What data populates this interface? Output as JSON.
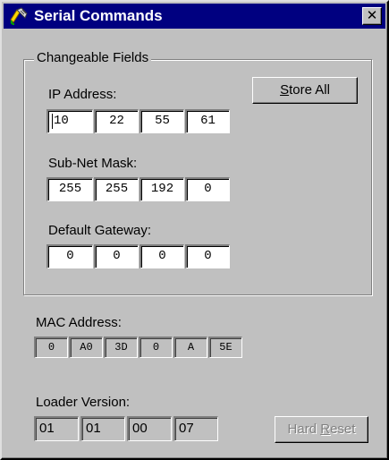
{
  "window": {
    "title": "Serial Commands",
    "icon": "serial-plug-icon",
    "close_label": "✕"
  },
  "changeable": {
    "legend": "Changeable Fields",
    "store_all": {
      "prefix": "",
      "accel": "S",
      "suffix": "tore All"
    },
    "ip_address": {
      "label": "IP Address:",
      "octets": [
        "10",
        "22",
        "55",
        "61"
      ]
    },
    "subnet_mask": {
      "label": "Sub-Net Mask:",
      "octets": [
        "255",
        "255",
        "192",
        "0"
      ]
    },
    "default_gateway": {
      "label": "Default Gateway:",
      "octets": [
        "0",
        "0",
        "0",
        "0"
      ]
    }
  },
  "mac_address": {
    "label": "MAC Address:",
    "bytes": [
      "0",
      "A0",
      "3D",
      "0",
      "A",
      "5E"
    ]
  },
  "loader_version": {
    "label": "Loader Version:",
    "parts": [
      "01",
      "01",
      "00",
      "07"
    ]
  },
  "hard_reset": {
    "prefix": "Hard ",
    "accel": "R",
    "suffix": "eset",
    "enabled": false
  },
  "colors": {
    "titlebar": "#000080",
    "face": "#c0c0c0",
    "shadow": "#808080",
    "highlight": "#ffffff"
  }
}
